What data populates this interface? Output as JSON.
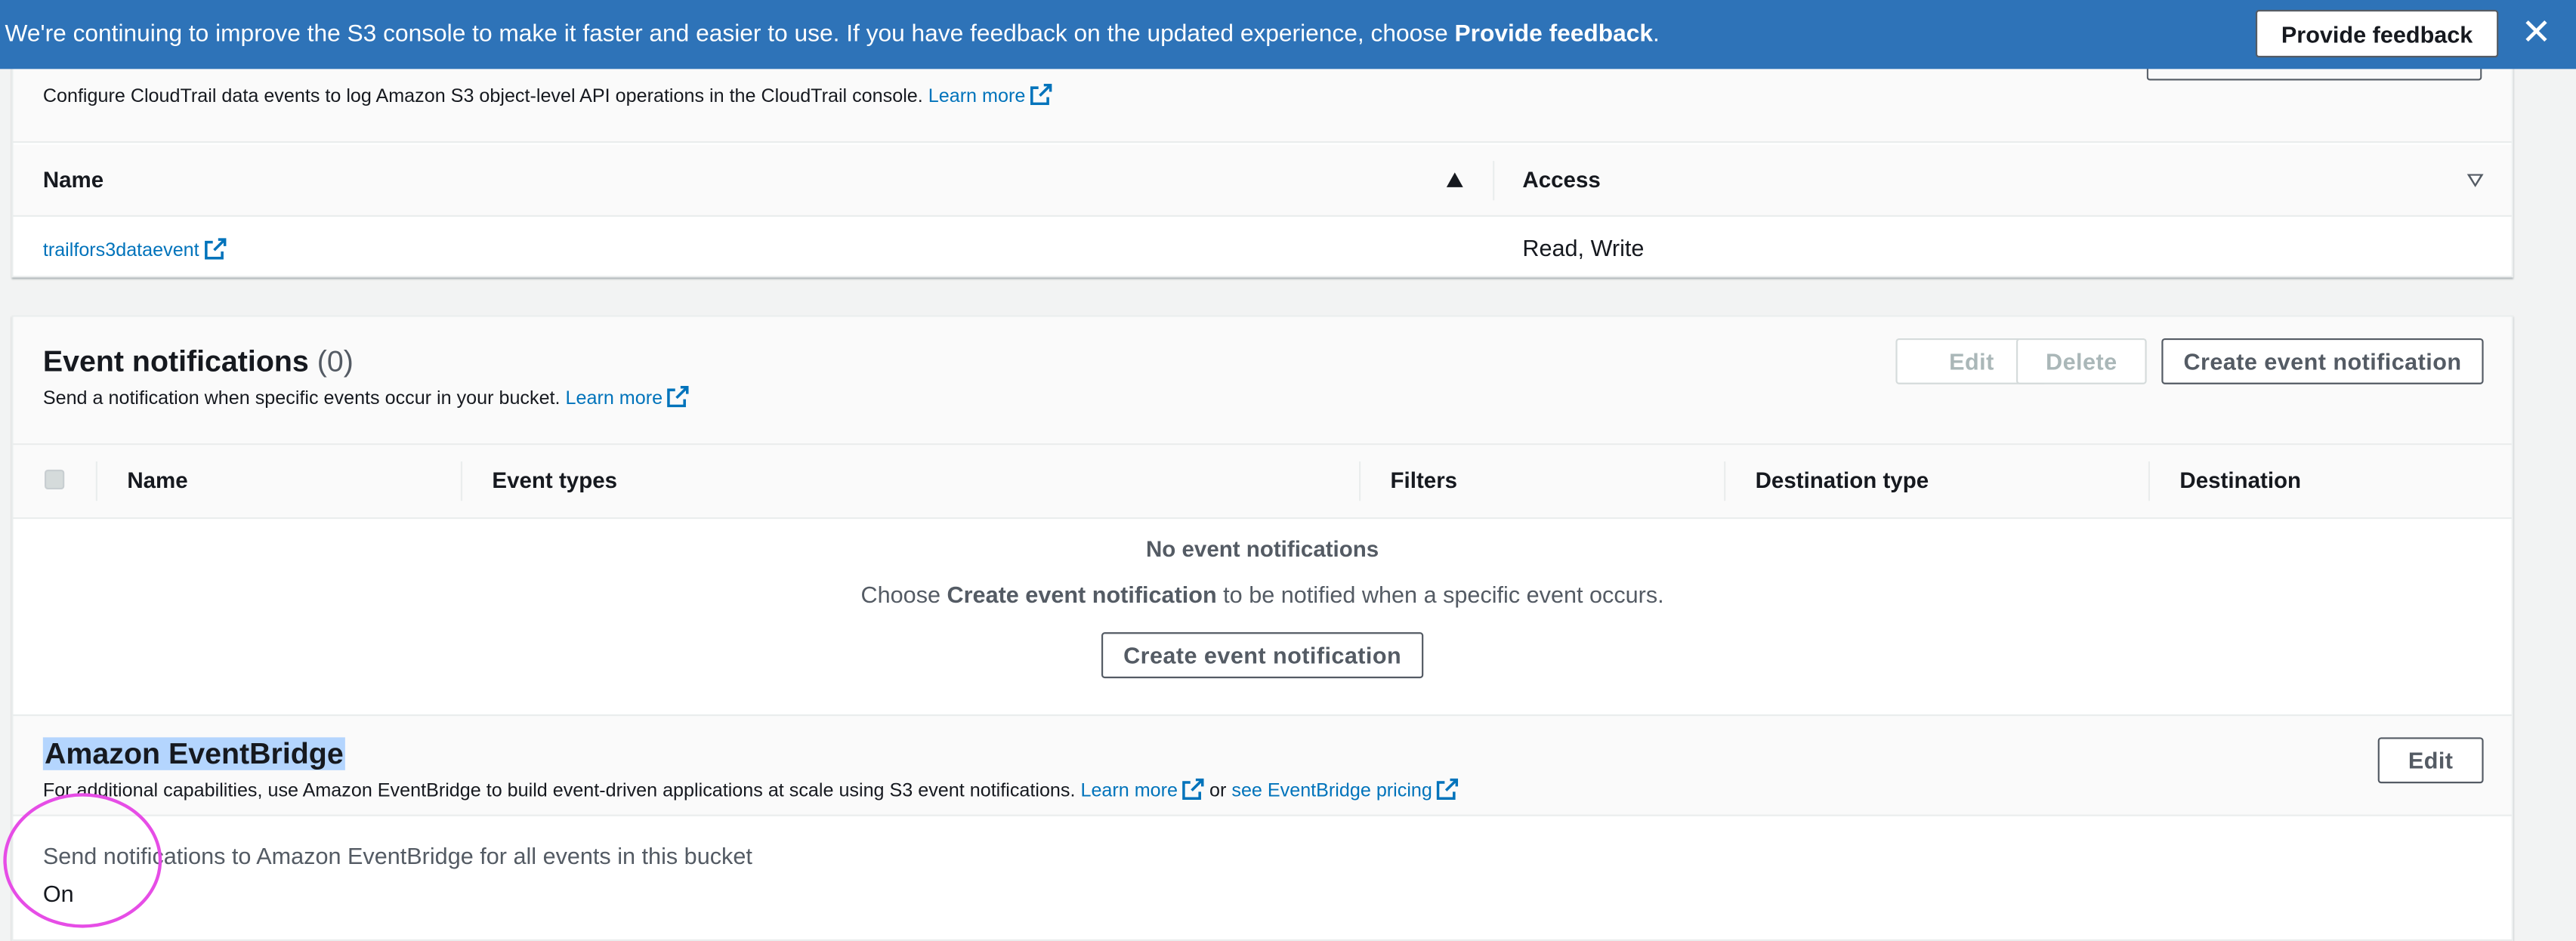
{
  "banner": {
    "text_pre": "We're continuing to improve the S3 console to make it faster and easier to use. If you have feedback on the updated experience, choose ",
    "text_bold": "Provide feedback",
    "text_post": ".",
    "button_label": "Provide feedback",
    "close_glyph": "✕"
  },
  "cloudtrail": {
    "description": "Configure CloudTrail data events to log Amazon S3 object-level API operations in the CloudTrail console.",
    "learn_more": "Learn more",
    "columns": [
      "Name",
      "Access"
    ],
    "rows": [
      {
        "name": "trailfors3dataevent",
        "access": "Read, Write"
      }
    ]
  },
  "event_notifications": {
    "title": "Event notifications",
    "count": "(0)",
    "description": "Send a notification when specific events occur in your bucket.",
    "learn_more": "Learn more",
    "buttons": {
      "edit": "Edit",
      "delete": "Delete",
      "create": "Create event notification"
    },
    "columns": [
      "Name",
      "Event types",
      "Filters",
      "Destination type",
      "Destination"
    ],
    "empty_title": "No event notifications",
    "empty_pre": "Choose ",
    "empty_bold": "Create event notification",
    "empty_post": " to be notified when a specific event occurs.",
    "empty_button": "Create event notification"
  },
  "eventbridge": {
    "title": "Amazon EventBridge",
    "description": "For additional capabilities, use Amazon EventBridge to build event-driven applications at scale using S3 event notifications.",
    "learn_more": "Learn more",
    "or": "or",
    "pricing_link": "see EventBridge pricing",
    "edit_button": "Edit",
    "setting_label": "Send notifications to Amazon EventBridge for all events in this bucket",
    "setting_value": "On"
  },
  "colors": {
    "banner_bg": "#2e73b8",
    "link": "#0073bb",
    "highlight": "#b4d5fe",
    "annotation": "#e64de6"
  }
}
